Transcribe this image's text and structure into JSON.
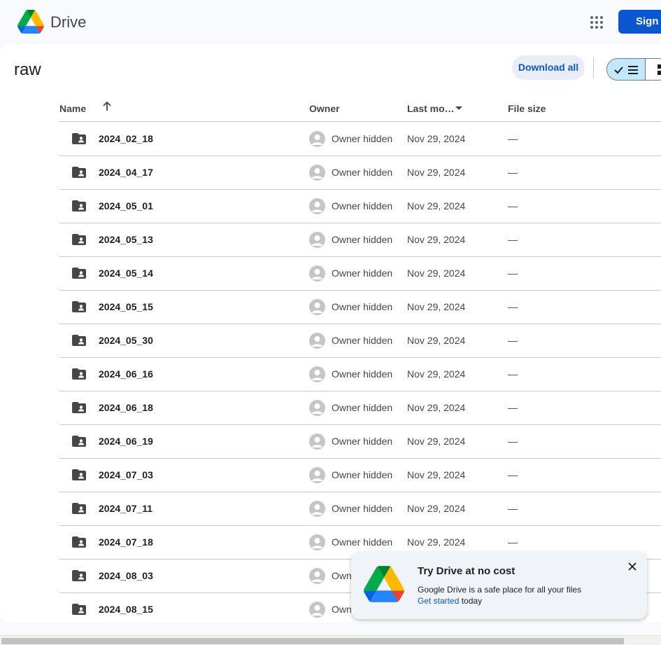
{
  "app": {
    "brand": "Drive",
    "signin_label": "Sign in"
  },
  "folder": {
    "title": "raw"
  },
  "toolbar": {
    "download_all_label": "Download all"
  },
  "table": {
    "columns": {
      "name": "Name",
      "owner": "Owner",
      "last_modified": "Last mo…",
      "file_size": "File size"
    },
    "rows": [
      {
        "name": "2024_02_18",
        "owner": "Owner hidden",
        "modified": "Nov 29, 2024",
        "size": "—"
      },
      {
        "name": "2024_04_17",
        "owner": "Owner hidden",
        "modified": "Nov 29, 2024",
        "size": "—"
      },
      {
        "name": "2024_05_01",
        "owner": "Owner hidden",
        "modified": "Nov 29, 2024",
        "size": "—"
      },
      {
        "name": "2024_05_13",
        "owner": "Owner hidden",
        "modified": "Nov 29, 2024",
        "size": "—"
      },
      {
        "name": "2024_05_14",
        "owner": "Owner hidden",
        "modified": "Nov 29, 2024",
        "size": "—"
      },
      {
        "name": "2024_05_15",
        "owner": "Owner hidden",
        "modified": "Nov 29, 2024",
        "size": "—"
      },
      {
        "name": "2024_05_30",
        "owner": "Owner hidden",
        "modified": "Nov 29, 2024",
        "size": "—"
      },
      {
        "name": "2024_06_16",
        "owner": "Owner hidden",
        "modified": "Nov 29, 2024",
        "size": "—"
      },
      {
        "name": "2024_06_18",
        "owner": "Owner hidden",
        "modified": "Nov 29, 2024",
        "size": "—"
      },
      {
        "name": "2024_06_19",
        "owner": "Owner hidden",
        "modified": "Nov 29, 2024",
        "size": "—"
      },
      {
        "name": "2024_07_03",
        "owner": "Owner hidden",
        "modified": "Nov 29, 2024",
        "size": "—"
      },
      {
        "name": "2024_07_11",
        "owner": "Owner hidden",
        "modified": "Nov 29, 2024",
        "size": "—"
      },
      {
        "name": "2024_07_18",
        "owner": "Owner hidden",
        "modified": "Nov 29, 2024",
        "size": "—"
      },
      {
        "name": "2024_08_03",
        "owner": "Owner hidden",
        "modified": "",
        "size": ""
      },
      {
        "name": "2024_08_15",
        "owner": "Owner hidden",
        "modified": "",
        "size": ""
      }
    ]
  },
  "promo": {
    "title": "Try Drive at no cost",
    "text": "Google Drive is a safe place for all your files",
    "link_label": "Get started",
    "link_suffix": "today"
  },
  "icons": {
    "logo": "google-drive-logo",
    "apps": "apps-grid-icon",
    "folder": "shared-folder-icon",
    "sort_up": "arrow-up-icon",
    "sort_down": "caret-down-icon",
    "view_list": "check-list-icon",
    "view_grid": "grid-icon",
    "close": "close-icon"
  },
  "colors": {
    "accent": "#0b57d0",
    "selected_toggle": "#c2e7ff",
    "pill_bg": "#e9eef6",
    "page_bg": "#f8fafd"
  }
}
